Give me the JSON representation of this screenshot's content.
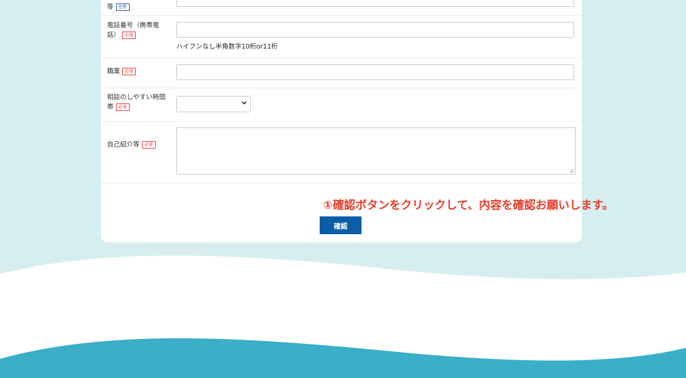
{
  "form": {
    "rows": [
      {
        "label_text": "等",
        "badge": "任意",
        "badge_type": "optional"
      },
      {
        "label_text": "電話番号（携帯電話）",
        "badge": "必須",
        "badge_type": "required",
        "hint": "ハイフンなし半角数字10桁or11桁"
      },
      {
        "label_text": "職業",
        "badge": "必須",
        "badge_type": "required"
      },
      {
        "label_text": "相談のしやすい時間帯",
        "badge": "必須",
        "badge_type": "required",
        "select_value": ""
      },
      {
        "label_text": "自己紹介等",
        "badge": "必須",
        "badge_type": "required"
      }
    ],
    "instruction": "①確認ボタンをクリックして、内容を確認お願いします。",
    "confirm_label": "確認"
  },
  "colors": {
    "background": "#d6eeee",
    "wave_bottom": "#3aafc7",
    "button": "#0a5ea8",
    "instruction": "#e53d2c",
    "required_badge": "#e44444",
    "optional_badge": "#2b5fa8"
  }
}
